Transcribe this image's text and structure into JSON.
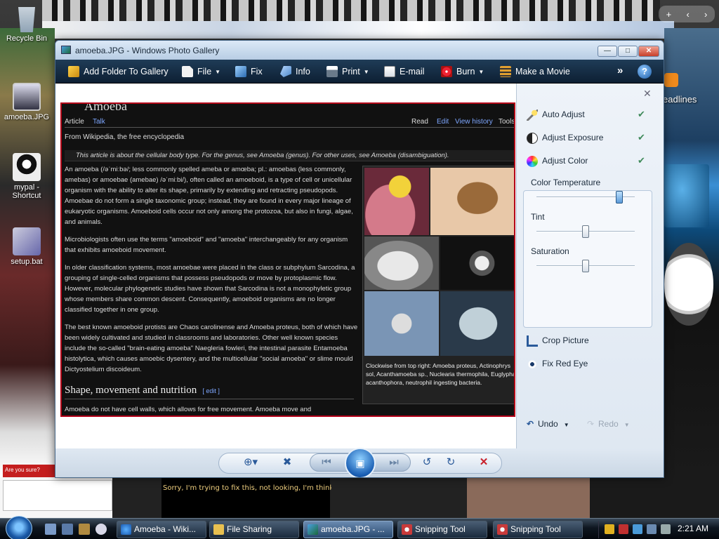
{
  "desktop": {
    "icons": [
      {
        "label": "Recycle Bin"
      },
      {
        "label": "amoeba.JPG"
      },
      {
        "label": "mypal - Shortcut"
      },
      {
        "label": "setup.bat"
      }
    ],
    "gadget_feed_label": "eadlines",
    "bottom_left_note": "Are you sure?",
    "bottom_caption": "Sorry, I'm trying to fix this, not looking, I'm thinking."
  },
  "window": {
    "title": "amoeba.JPG - Windows Photo Gallery",
    "buttons": {
      "minimize": "—",
      "maximize": "□",
      "close": "✕"
    }
  },
  "toolbar": {
    "add_folder": "Add Folder To Gallery",
    "file": "File",
    "fix": "Fix",
    "info": "Info",
    "print": "Print",
    "email": "E-mail",
    "burn": "Burn",
    "make_movie": "Make a Movie",
    "more": "»",
    "help": "?"
  },
  "photo": {
    "heading": "Amoeba",
    "nav_left": [
      "Article",
      "Talk"
    ],
    "nav_right": [
      "Read",
      "Edit",
      "View history",
      "Tools"
    ],
    "from": "From Wikipedia, the free encyclopedia",
    "hatnote": "This article is about the cellular body type. For the genus, see Amoeba (genus). For other uses, see Amoeba (disambiguation).",
    "p1": "An amoeba (/əˈmiːbə/; less commonly spelled ameba or amœba; pl.: amoebas (less commonly, amebas) or amoebae (amebae) /əˈmiːbi/), often called an amoeboid, is a type of cell or unicellular organism with the ability to alter its shape, primarily by extending and retracting pseudopods. Amoebae do not form a single taxonomic group; instead, they are found in every major lineage of eukaryotic organisms. Amoeboid cells occur not only among the protozoa, but also in fungi, algae, and animals.",
    "p2": "Microbiologists often use the terms \"amoeboid\" and \"amoeba\" interchangeably for any organism that exhibits amoeboid movement.",
    "p3": "In older classification systems, most amoebae were placed in the class or subphylum Sarcodina, a grouping of single-celled organisms that possess pseudopods or move by protoplasmic flow. However, molecular phylogenetic studies have shown that Sarcodina is not a monophyletic group whose members share common descent. Consequently, amoeboid organisms are no longer classified together in one group.",
    "p4": "The best known amoeboid protists are Chaos carolinense and Amoeba proteus, both of which have been widely cultivated and studied in classrooms and laboratories. Other well known species include the so-called \"brain-eating amoeba\" Naegleria fowleri, the intestinal parasite Entamoeba histolytica, which causes amoebic dysentery, and the multicellular \"social amoeba\" or slime mould Dictyostelium discoideum.",
    "section": "Shape, movement and nutrition",
    "edit": "[ edit ]",
    "last": "Amoeba do not have cell walls, which allows for free movement. Amoeba move and",
    "caption": "Clockwise from top right: Amoeba proteus, Actinophrys sol, Acanthamoeba sp., Nuclearia thermophila, Euglypha acanthophora, neutrophil ingesting bacteria."
  },
  "fixpane": {
    "close": "✕",
    "auto_adjust": "Auto Adjust",
    "adjust_exposure": "Adjust Exposure",
    "adjust_color": "Adjust Color",
    "check": "✔",
    "sliders": [
      {
        "label": "Color Temperature",
        "value": 0.84
      },
      {
        "label": "Tint",
        "value": 0.5
      },
      {
        "label": "Saturation",
        "value": 0.5
      }
    ],
    "crop": "Crop Picture",
    "red_eye": "Fix Red Eye",
    "undo": "Undo",
    "redo": "Redo"
  },
  "controls": {
    "zoom": "⊕▾",
    "fit": "✖",
    "prev": "⏮",
    "slideshow": "▣",
    "next": "⏭",
    "rotate_ccw": "↺",
    "rotate_cw": "↻",
    "delete": "✕"
  },
  "taskbar": {
    "tasks": [
      {
        "label": "Amoeba - Wiki..."
      },
      {
        "label": "File Sharing"
      },
      {
        "label": "amoeba.JPG - ..."
      },
      {
        "label": "Snipping Tool"
      },
      {
        "label": "Snipping Tool"
      }
    ],
    "clock": "2:21 AM"
  }
}
